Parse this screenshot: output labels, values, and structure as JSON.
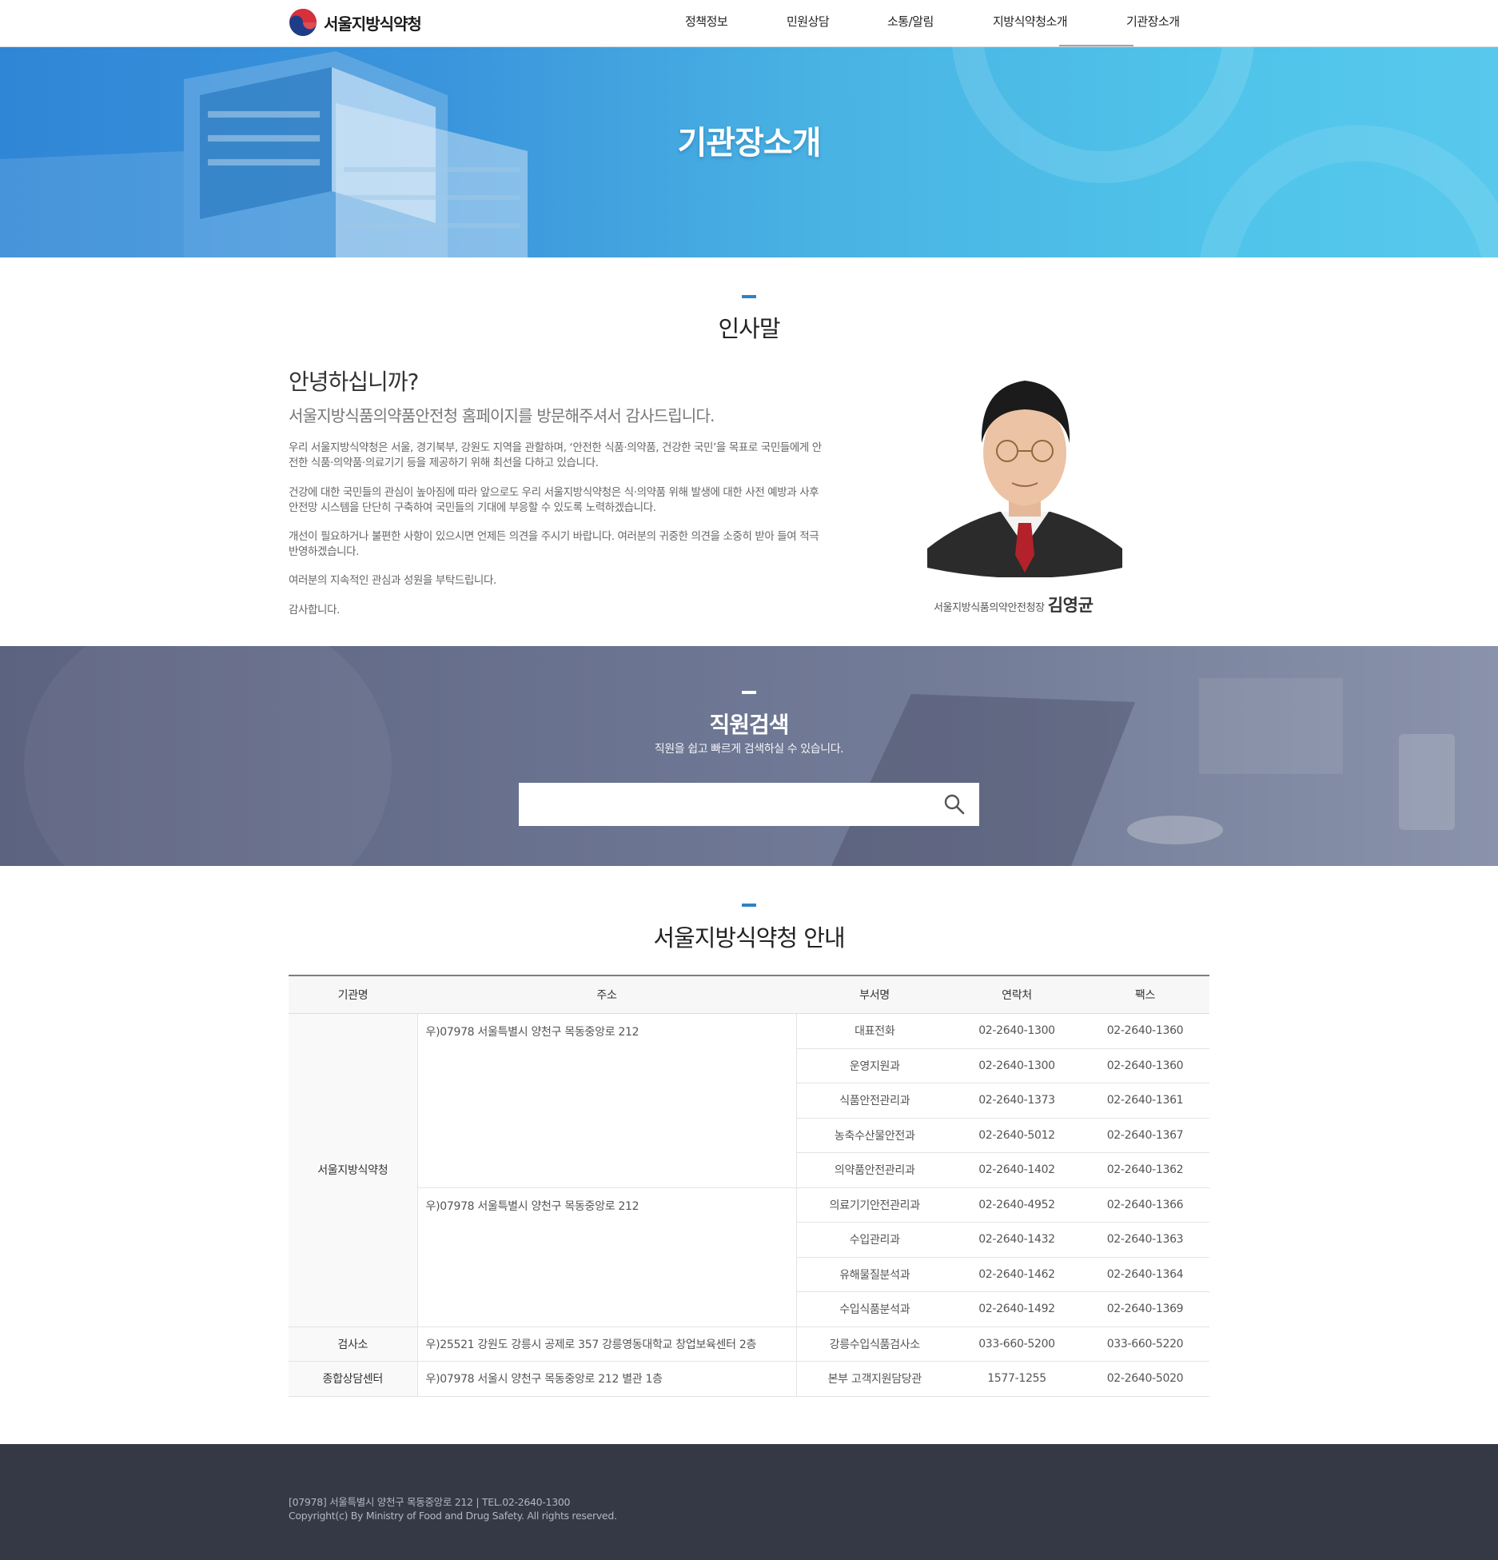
{
  "header": {
    "logo_text": "서울지방식약청",
    "nav": [
      "정책정보",
      "민원상담",
      "소통/알림",
      "지방식약청소개",
      "기관장소개"
    ]
  },
  "hero": {
    "title": "기관장소개"
  },
  "greeting": {
    "section_title": "인사말",
    "title": "안녕하십니까?",
    "subtitle": "서울지방식품의약품안전청 홈페이지를 방문해주셔서 감사드립니다.",
    "paragraphs": [
      "우리 서울지방식약청은 서울, 경기북부, 강원도 지역을 관할하며, ‘안전한 식품·의약품, 건강한 국민’을 목표로 국민들에게 안전한 식품·의약품·의료기기 등을 제공하기 위해 최선을 다하고 있습니다.",
      "건강에 대한 국민들의 관심이 높아짐에 따라 앞으로도 우리 서울지방식약청은 식·의약품 위해 발생에 대한 사전 예방과 사후안전망 시스템을 단단히 구축하여 국민들의 기대에 부응할 수 있도록 노력하겠습니다.",
      "개선이 필요하거나 불편한 사항이 있으시면 언제든 의견을 주시기 바랍니다. 여러분의 귀중한 의견을 소중히 받아 들여 적극 반영하겠습니다.",
      "여러분의 지속적인 관심과 성원을 부탁드립니다.",
      "감사합니다."
    ],
    "signature_position": "서울지방식품의약안전청장",
    "signature_name": "김영균"
  },
  "search": {
    "title": "직원검색",
    "description": "직원을 쉽고 빠르게 검색하실 수 있습니다.",
    "input_value": "",
    "placeholder": ""
  },
  "guide": {
    "section_title": "서울지방식약청 안내",
    "headers": [
      "기관명",
      "주소",
      "부서명",
      "연락처",
      "팩스"
    ],
    "rows": [
      {
        "org": "서울지방식약청",
        "addr": "우)07978 서울특별시 양천구 목동중앙로 212",
        "dept": "대표전화",
        "tel": "02-2640-1300",
        "fax": "02-2640-1360"
      },
      {
        "dept": "운영지원과",
        "tel": "02-2640-1300",
        "fax": "02-2640-1360"
      },
      {
        "dept": "식품안전관리과",
        "tel": "02-2640-1373",
        "fax": "02-2640-1361"
      },
      {
        "dept": "농축수산물안전과",
        "tel": "02-2640-5012",
        "fax": "02-2640-1367"
      },
      {
        "dept": "의약품안전관리과",
        "tel": "02-2640-1402",
        "fax": "02-2640-1362"
      },
      {
        "addr": "우)07978 서울특별시 양천구 목동중앙로 212",
        "dept": "의료기기안전관리과",
        "tel": "02-2640-4952",
        "fax": "02-2640-1366"
      },
      {
        "dept": "수입관리과",
        "tel": "02-2640-1432",
        "fax": "02-2640-1363"
      },
      {
        "dept": "유해물질분석과",
        "tel": "02-2640-1462",
        "fax": "02-2640-1364"
      },
      {
        "dept": "수입식품분석과",
        "tel": "02-2640-1492",
        "fax": "02-2640-1369"
      },
      {
        "org": "검사소",
        "addr": "우)25521 강원도 강릉시 공제로 357 강릉영동대학교 창업보육센터 2층",
        "dept": "강릉수입식품검사소",
        "tel": "033-660-5200",
        "fax": "033-660-5220"
      },
      {
        "org": "종합상담센터",
        "addr": "우)07978 서울시 양천구 목동중앙로 212 별관 1층",
        "dept": "본부 고객지원담당관",
        "tel": "1577-1255",
        "fax": "02-2640-5020"
      }
    ]
  },
  "footer": {
    "address": "[07978] 서울특별시 양천구 목동중앙로 212  |  TEL.02-2640-1300",
    "copyright": "Copyright(c) By Ministry of Food and Drug Safety. All rights reserved."
  },
  "colors": {
    "accent": "#2e83c5",
    "footer_bg": "#353945",
    "hero_blue": "#49b3e3",
    "search_bg": "#6a7390"
  },
  "icons": {
    "logo": "taegeuk-emblem-icon",
    "search": "magnifier-search-icon"
  }
}
